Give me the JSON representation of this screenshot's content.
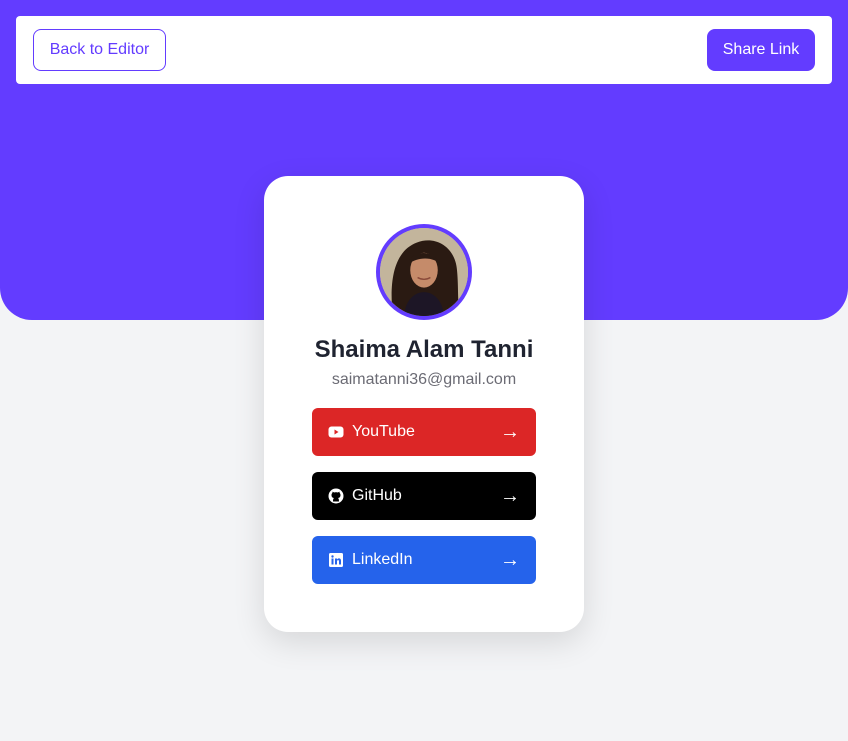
{
  "topbar": {
    "back_label": "Back to Editor",
    "share_label": "Share Link"
  },
  "colors": {
    "brand": "#633cff",
    "youtube": "#dc2626",
    "github": "#000000",
    "linkedin": "#2563eb"
  },
  "profile": {
    "name": "Shaima Alam Tanni",
    "email": "saimatanni36@gmail.com"
  },
  "links": [
    {
      "label": "YouTube",
      "icon": "youtube-icon",
      "arrow": "→"
    },
    {
      "label": "GitHub",
      "icon": "github-icon",
      "arrow": "→"
    },
    {
      "label": "LinkedIn",
      "icon": "linkedin-icon",
      "arrow": "→"
    }
  ]
}
